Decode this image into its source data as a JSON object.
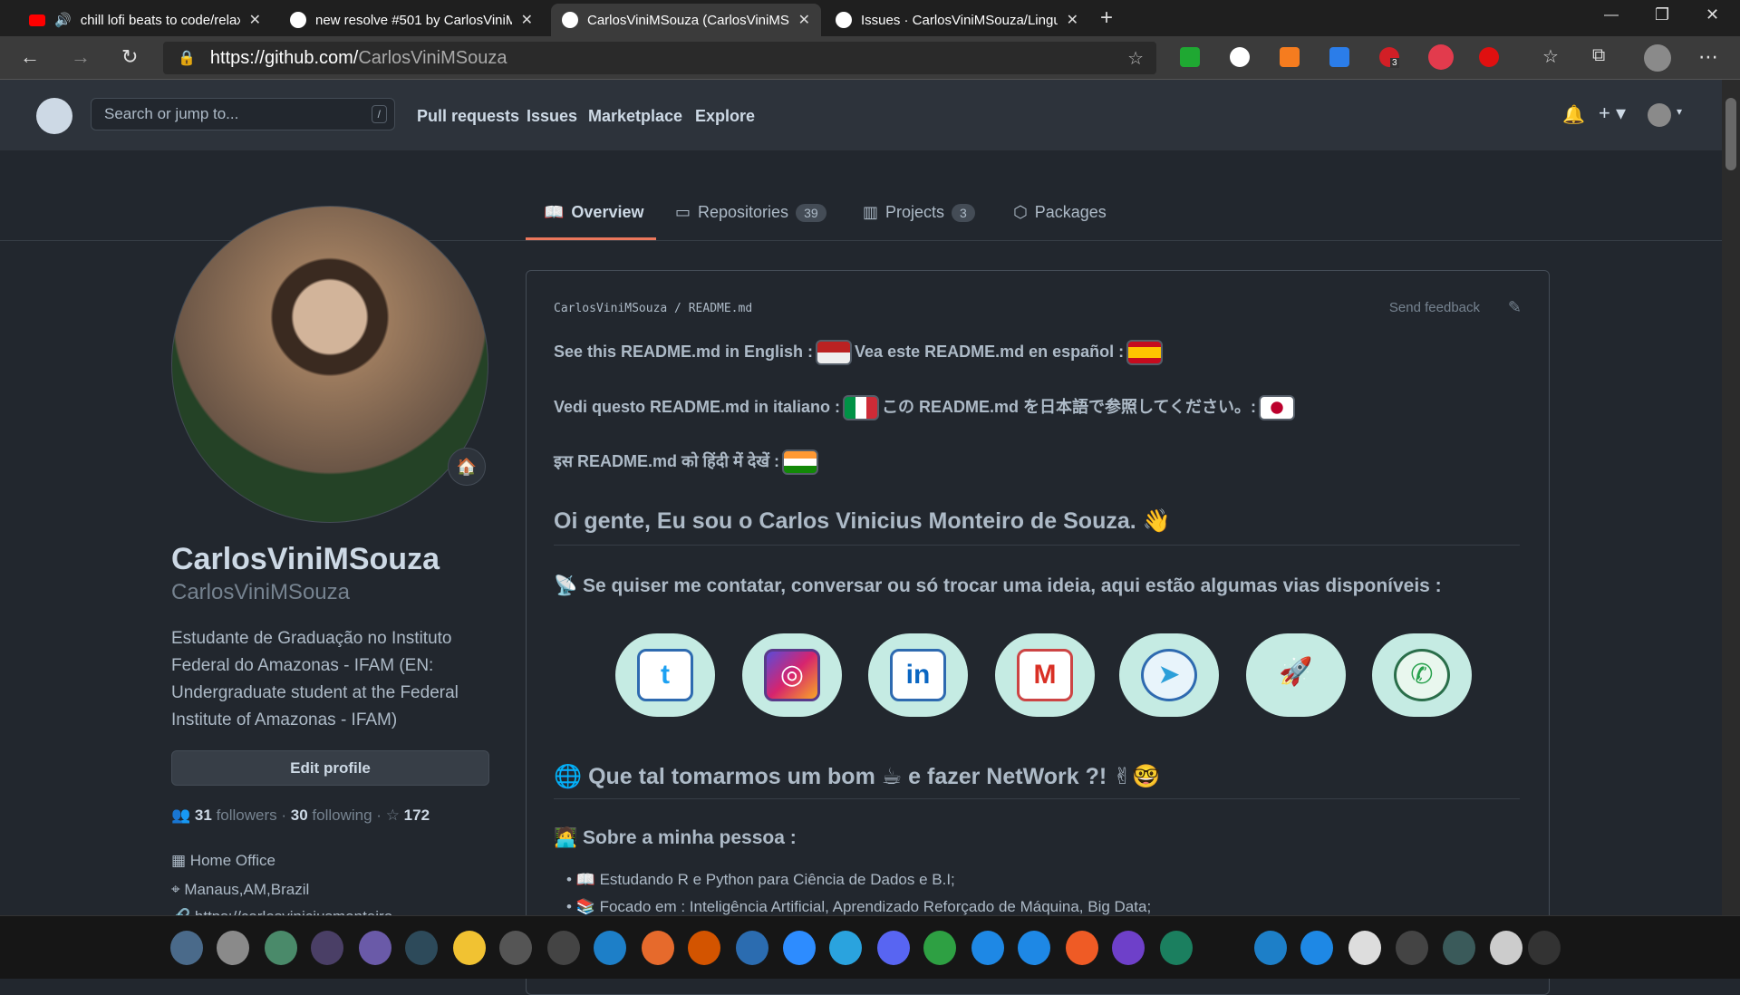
{
  "browser": {
    "tabs": [
      {
        "title": "chill lofi beats to code/relax",
        "icon": "youtube-icon"
      },
      {
        "title": "new resolve #501 by CarlosViniM",
        "icon": "github-icon"
      },
      {
        "title": "CarlosViniMSouza (CarlosViniMS",
        "icon": "github-icon",
        "active": true
      },
      {
        "title": "Issues · CarlosViniMSouza/Lingu",
        "icon": "github-icon"
      }
    ],
    "url_host": "https://github.com/",
    "url_path": "CarlosViniMSouza",
    "extension_badge": "3"
  },
  "header": {
    "search_placeholder": "Search or jump to...",
    "slash": "/",
    "nav": [
      "Pull requests",
      "Issues",
      "Marketplace",
      "Explore"
    ]
  },
  "profile_tabs": [
    {
      "label": "Overview",
      "count": null
    },
    {
      "label": "Repositories",
      "count": "39"
    },
    {
      "label": "Projects",
      "count": "3"
    },
    {
      "label": "Packages",
      "count": null
    }
  ],
  "profile": {
    "name": "CarlosViniMSouza",
    "login": "CarlosViniMSouza",
    "bio": "Estudante de Graduação no Instituto Federal do Amazonas - IFAM (EN: Undergraduate student at the Federal Institute of Amazonas - IFAM)",
    "edit_label": "Edit profile",
    "followers": "31",
    "followers_label": "followers",
    "following": "30",
    "following_label": "following",
    "stars": "172",
    "company": "Home Office",
    "location": "Manaus,AM,Brazil",
    "website": "https://carlosviniciusmonteiro..."
  },
  "readme": {
    "crumb_user": "CarlosViniMSouza",
    "crumb_file": "README.md",
    "feedback": "Send feedback",
    "line1a": "See this README.md in English :",
    "line1b": "Vea este README.md en español :",
    "line2a": "Vedi questo README.md in italiano :",
    "line2b": "この README.md を日本語で参照してください。:",
    "line3": "इस README.md को हिंदी में देखें :",
    "greeting": "Oi gente, Eu sou o Carlos Vinicius Monteiro de Souza. 👋",
    "contact": "Se quiser me contatar, conversar ou só trocar uma ideia, aqui estão algumas vias disponíveis :",
    "social": [
      "twitter",
      "instagram",
      "linkedin",
      "gmail",
      "telegram",
      "rocket",
      "whatsapp"
    ],
    "network_a": "Que tal tomarmos um bom",
    "network_b": "e fazer NetWork ?! ✌🤓",
    "about": "Sobre a minha pessoa :",
    "items": [
      "Estudando R e Python para Ciência de Dados e B.I;",
      "Focado em : Inteligência Artificial, Aprendizado Reforçado de Máquina, Big Data;"
    ]
  },
  "taskbar": [
    "windows",
    "power",
    "refresh",
    "moon",
    "tasks",
    "search",
    "files",
    "monitor",
    "trash",
    "edge",
    "firefox",
    "impress",
    "writer",
    "zoom",
    "telegram",
    "discord",
    "circle",
    "vscode",
    "azure",
    "postman",
    "github-desktop",
    "terminal",
    "edge",
    "vscode",
    "display",
    "keyboard",
    "network",
    "tray",
    "volume"
  ]
}
